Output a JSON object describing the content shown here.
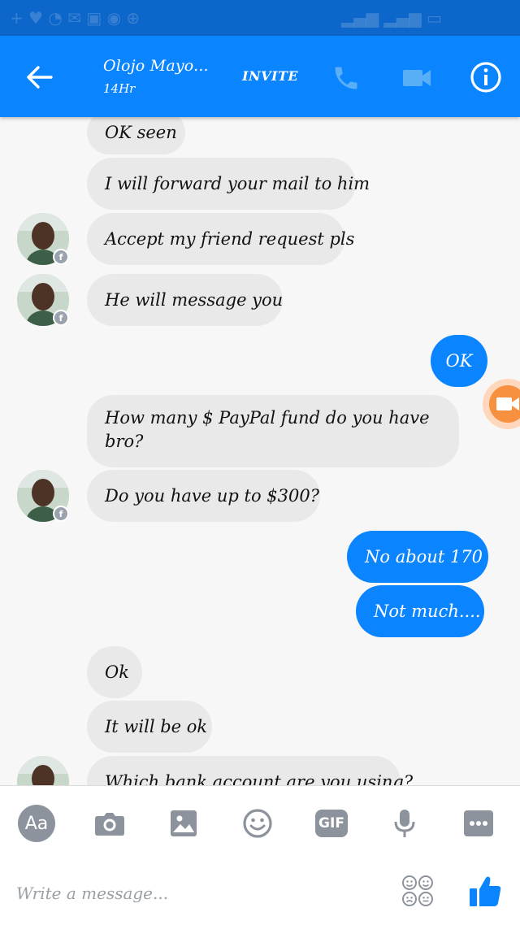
{
  "header": {
    "contact_name": "Olojo Mayo...",
    "contact_status": "14Hr",
    "invite_label": "INVITE"
  },
  "messages": [
    {
      "side": "in",
      "text": "OK seen"
    },
    {
      "side": "in",
      "text": "I will forward your mail to him"
    },
    {
      "side": "in",
      "text": "Accept my friend request pls"
    },
    {
      "side": "in",
      "text": "He will message you"
    },
    {
      "side": "out",
      "text": "OK"
    },
    {
      "side": "in",
      "text": "How many $ PayPal fund do you have bro?"
    },
    {
      "side": "in",
      "text": "Do you have up to $300?"
    },
    {
      "side": "out",
      "text": "No about 170"
    },
    {
      "side": "out",
      "text": "Not much...."
    },
    {
      "side": "in",
      "text": "Ok"
    },
    {
      "side": "in",
      "text": "It will be ok"
    },
    {
      "side": "in",
      "text": "Which bank account are you using?"
    }
  ],
  "composer": {
    "aa_label": "Aa",
    "gif_label": "GIF",
    "placeholder": "Write a message..."
  },
  "colors": {
    "header_blue": "#0a84ff",
    "status_bar": "#0d66c9",
    "incoming_bubble": "#e9e9e9",
    "outgoing_bubble": "#0a84ff",
    "video_chat_accent": "#f7903f"
  },
  "icons": [
    "back-arrow-icon",
    "phone-icon",
    "video-camera-icon",
    "info-icon",
    "camera-icon",
    "image-icon",
    "emoji-icon",
    "microphone-icon",
    "more-icon",
    "stickers-icon",
    "like-icon",
    "facebook-badge-icon"
  ]
}
